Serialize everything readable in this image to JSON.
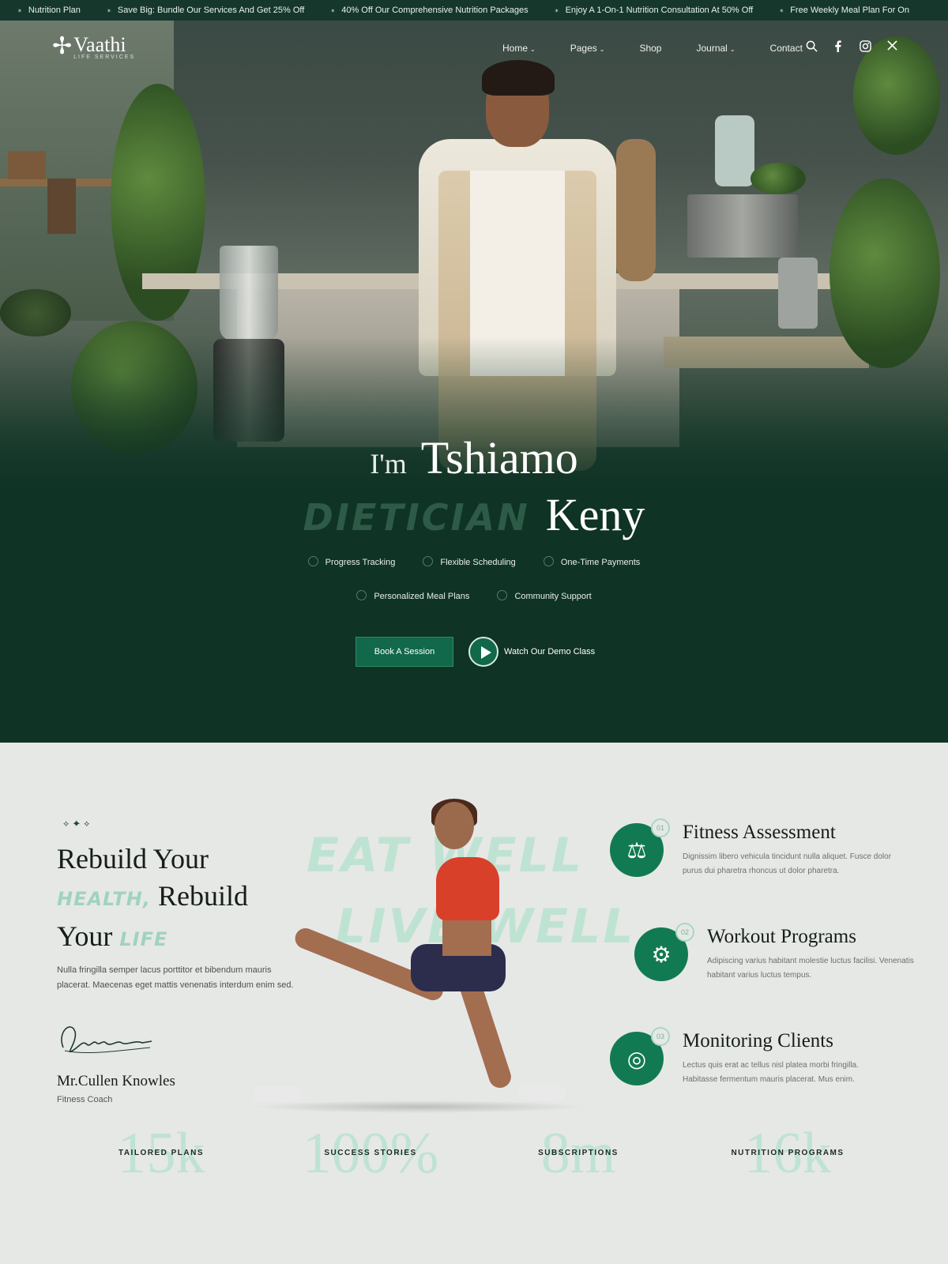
{
  "ticker": [
    "Nutrition Plan",
    "Save Big: Bundle Our Services And Get 25% Off",
    "40% Off Our Comprehensive Nutrition Packages",
    "Enjoy A 1-On-1 Nutrition Consultation At 50% Off",
    "Free Weekly Meal Plan For On"
  ],
  "brand": {
    "name": "Vaathi",
    "tagline": "LIFE SERVICES",
    "mark": "✢"
  },
  "nav": {
    "items": [
      {
        "label": "Home",
        "caret": "⌄"
      },
      {
        "label": "Pages",
        "caret": "⌄"
      },
      {
        "label": "Shop",
        "caret": ""
      },
      {
        "label": "Journal",
        "caret": "⌄"
      },
      {
        "label": "Contact",
        "caret": ""
      }
    ],
    "icons": [
      "search-icon",
      "facebook-icon",
      "instagram-icon",
      "x-icon"
    ]
  },
  "hero": {
    "greeting": "I'm",
    "first_name": "Tshiamo",
    "role": "Dietician",
    "last_name": "Keny",
    "features_row1": [
      "Progress Tracking",
      "Flexible Scheduling",
      "One-Time Payments"
    ],
    "features_row2": [
      "Personalized Meal Plans",
      "Community Support"
    ],
    "cta_label": "Book A Session",
    "demo_label": "Watch Our Demo Class"
  },
  "about": {
    "ornament": "⟡ ✦ ⟡",
    "title_line1": "Rebuild Your",
    "title_accent1": "Health,",
    "title_line2": "Rebuild",
    "title_line3": "Your",
    "title_accent2": "Life",
    "paragraph": "Nulla fringilla semper lacus porttitor et bibendum mauris placerat. Maecenas eget mattis venenatis interdum enim sed.",
    "author_name": "Mr.Cullen Knowles",
    "author_role": "Fitness Coach",
    "bg_text_line1": "Eat Well",
    "bg_text_line2": "Live Well"
  },
  "services": [
    {
      "num": "01",
      "icon": "fitness-assessment-icon",
      "glyph": "⚖",
      "title": "Fitness Assessment",
      "desc": "Dignissim libero vehicula tincidunt nulla aliquet. Fusce dolor purus dui pharetra rhoncus ut dolor pharetra."
    },
    {
      "num": "02",
      "icon": "workout-programs-icon",
      "glyph": "⚙",
      "title": "Workout Programs",
      "desc": "Adipiscing varius habitant molestie luctus facilisi. Venenatis habitant varius luctus tempus."
    },
    {
      "num": "03",
      "icon": "monitoring-clients-icon",
      "glyph": "◎",
      "title": "Monitoring Clients",
      "desc": "Lectus quis erat ac tellus nisl platea morbi fringilla. Habitasse fermentum mauris placerat. Mus enim."
    }
  ],
  "stats": [
    {
      "number": "15k",
      "label": "Tailored Plans"
    },
    {
      "number": "100%",
      "label": "Success Stories"
    },
    {
      "number": "8m",
      "label": "Subscriptions"
    },
    {
      "number": "16k",
      "label": "Nutrition Programs"
    }
  ],
  "colors": {
    "brand_green": "#127a52",
    "dark_green": "#0f3325",
    "mint": "#bfe3d3"
  }
}
